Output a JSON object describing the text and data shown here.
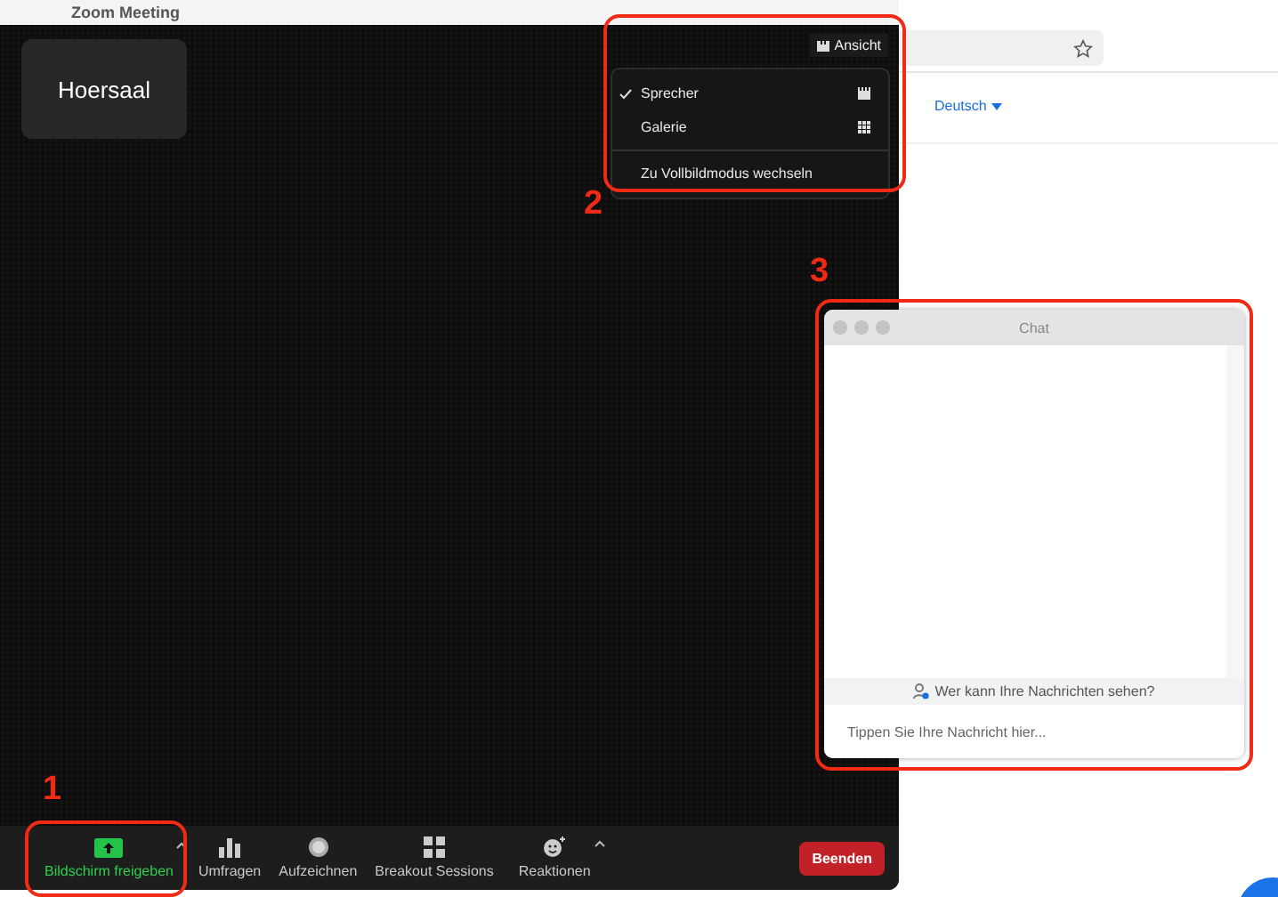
{
  "zoom_window": {
    "title": "Zoom Meeting",
    "name_tile": "Hoersaal",
    "view_button": "Ansicht",
    "view_menu": [
      {
        "label": "Sprecher",
        "selected": true
      },
      {
        "label": "Galerie",
        "selected": false
      }
    ],
    "fullscreen_item": "Zu Vollbildmodus wechseln",
    "toolbar": [
      {
        "label": "Bildschirm freigeben",
        "active": true,
        "has_menu": true
      },
      {
        "label": "Umfragen",
        "active": false,
        "has_menu": false
      },
      {
        "label": "Aufzeichnen",
        "active": false,
        "has_menu": false
      },
      {
        "label": "Breakout Sessions",
        "active": false,
        "has_menu": false
      },
      {
        "label": "Reaktionen",
        "active": false,
        "has_menu": true
      }
    ],
    "end_button": "Beenden"
  },
  "browser": {
    "language": "Deutsch"
  },
  "chat": {
    "title": "Chat",
    "privacy_hint": "Wer kann Ihre Nachrichten sehen?",
    "input": {
      "placeholder": "Tippen Sie Ihre Nachricht hier..."
    }
  },
  "annotations": [
    {
      "label": "1"
    },
    {
      "label": "2"
    },
    {
      "label": "3"
    }
  ]
}
